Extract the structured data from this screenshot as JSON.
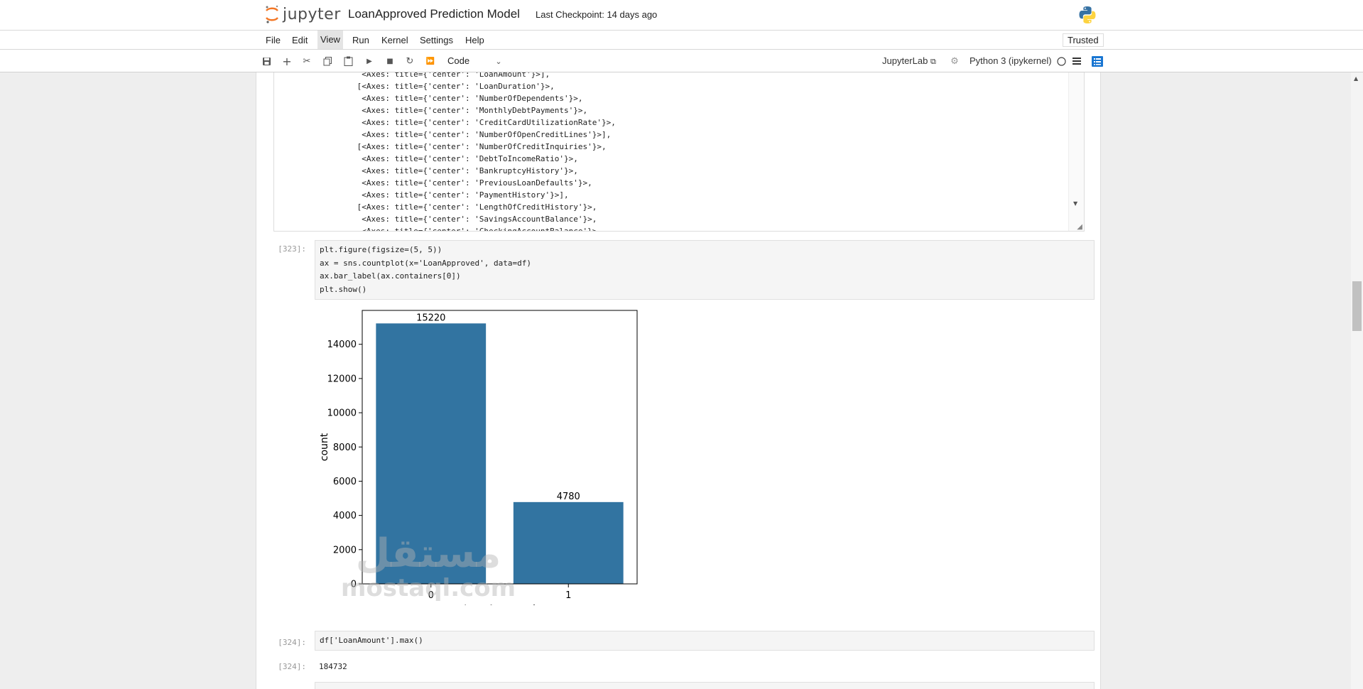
{
  "header": {
    "logo_text": "jupyter",
    "notebook_title": "LoanApproved Prediction Model",
    "checkpoint": "Last Checkpoint: 14 days ago"
  },
  "menubar": {
    "items": [
      "File",
      "Edit",
      "View",
      "Run",
      "Kernel",
      "Settings",
      "Help"
    ],
    "active": "View",
    "trusted_label": "Trusted"
  },
  "toolbar": {
    "cell_type": "Code",
    "jupyterlab_label": "JupyterLab",
    "kernel_name": "Python 3 (ipykernel)",
    "icons": [
      "save-icon",
      "add-cell-icon",
      "cut-icon",
      "copy-icon",
      "paste-icon",
      "run-icon",
      "stop-icon",
      "restart-icon",
      "fast-forward-icon"
    ]
  },
  "output_scroll": {
    "lines": [
      "  <Axes: title={'center': 'LoanAmount'}>],",
      " [<Axes: title={'center': 'LoanDuration'}>,",
      "  <Axes: title={'center': 'NumberOfDependents'}>,",
      "  <Axes: title={'center': 'MonthlyDebtPayments'}>,",
      "  <Axes: title={'center': 'CreditCardUtilizationRate'}>,",
      "  <Axes: title={'center': 'NumberOfOpenCreditLines'}>],",
      " [<Axes: title={'center': 'NumberOfCreditInquiries'}>,",
      "  <Axes: title={'center': 'DebtToIncomeRatio'}>,",
      "  <Axes: title={'center': 'BankruptcyHistory'}>,",
      "  <Axes: title={'center': 'PreviousLoanDefaults'}>,",
      "  <Axes: title={'center': 'PaymentHistory'}>],",
      " [<Axes: title={'center': 'LengthOfCreditHistory'}>,",
      "  <Axes: title={'center': 'SavingsAccountBalance'}>,",
      "  <Axes: title={'center': 'CheckingAccountBalance'}>,"
    ]
  },
  "cells": {
    "c323": {
      "prompt": "[323]:",
      "lines": [
        "plt.figure(figsize=(5, 5))",
        "ax = sns.countplot(x='LoanApproved', data=df)",
        "ax.bar_label(ax.containers[0])",
        "plt.show()"
      ]
    },
    "c324": {
      "prompt": "[324]:",
      "lines": [
        "df['LoanAmount'].max()"
      ],
      "out_prompt": "[324]:",
      "output": "184732"
    }
  },
  "chart_data": {
    "type": "bar",
    "categories": [
      "0",
      "1"
    ],
    "values": [
      15220,
      4780
    ],
    "data_labels": [
      "15220",
      "4780"
    ],
    "xlabel": "LoanApproved",
    "ylabel": "count",
    "ylim": [
      0,
      15980
    ],
    "yticks": [
      0,
      2000,
      4000,
      6000,
      8000,
      10000,
      12000,
      14000
    ],
    "bar_color": "#3274a1",
    "grid": false
  },
  "watermark": {
    "arabic": "مستقل",
    "latin": "mostaql.com"
  }
}
